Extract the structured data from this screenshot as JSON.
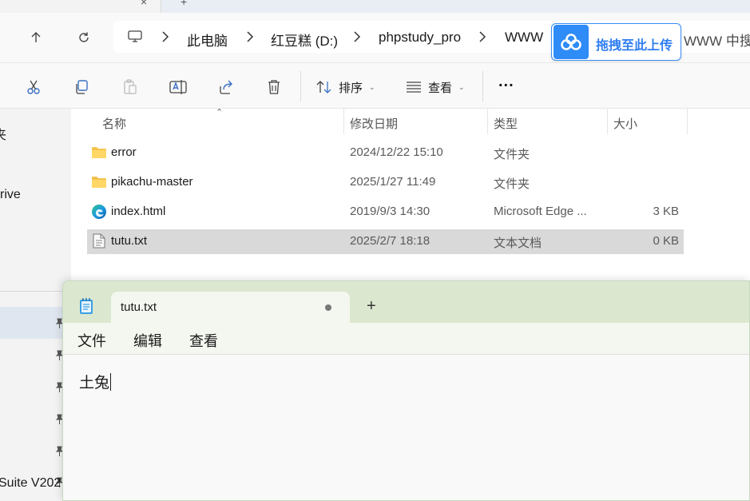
{
  "explorer": {
    "tab": {
      "close_glyph": "×",
      "new_glyph": "+"
    },
    "nav": {
      "up_icon": "arrow-up-icon",
      "refresh_icon": "refresh-icon"
    },
    "breadcrumbs": [
      "此电脑",
      "红豆糕 (D:)",
      "phpstudy_pro",
      "WWW"
    ],
    "search": {
      "placeholder": "WWW 中搜"
    },
    "baidu_popup": {
      "label": "拖拽至此上传"
    },
    "toolbar": {
      "sort_label": "排序",
      "view_label": "查看",
      "more_label": "..."
    },
    "left_pane": {
      "items": [
        "夹",
        "rive",
        "Suite V202"
      ]
    },
    "columns": {
      "name": "名称",
      "date": "修改日期",
      "type": "类型",
      "size": "大小"
    },
    "files": [
      {
        "name": "error",
        "date": "2024/12/22 15:10",
        "type": "文件夹",
        "size": "",
        "icon": "folder-icon"
      },
      {
        "name": "pikachu-master",
        "date": "2025/1/27 11:49",
        "type": "文件夹",
        "size": "",
        "icon": "folder-icon"
      },
      {
        "name": "index.html",
        "date": "2019/9/3 14:30",
        "type": "Microsoft Edge ...",
        "size": "3 KB",
        "icon": "edge-icon"
      },
      {
        "name": "tutu.txt",
        "date": "2025/2/7 18:18",
        "type": "文本文档",
        "size": "0 KB",
        "icon": "text-file-icon"
      }
    ],
    "selected_file": "tutu.txt"
  },
  "notepad": {
    "tab_title": "tutu.txt",
    "new_tab_glyph": "+",
    "menu": [
      "文件",
      "编辑",
      "查看"
    ],
    "content": "土兔"
  }
}
